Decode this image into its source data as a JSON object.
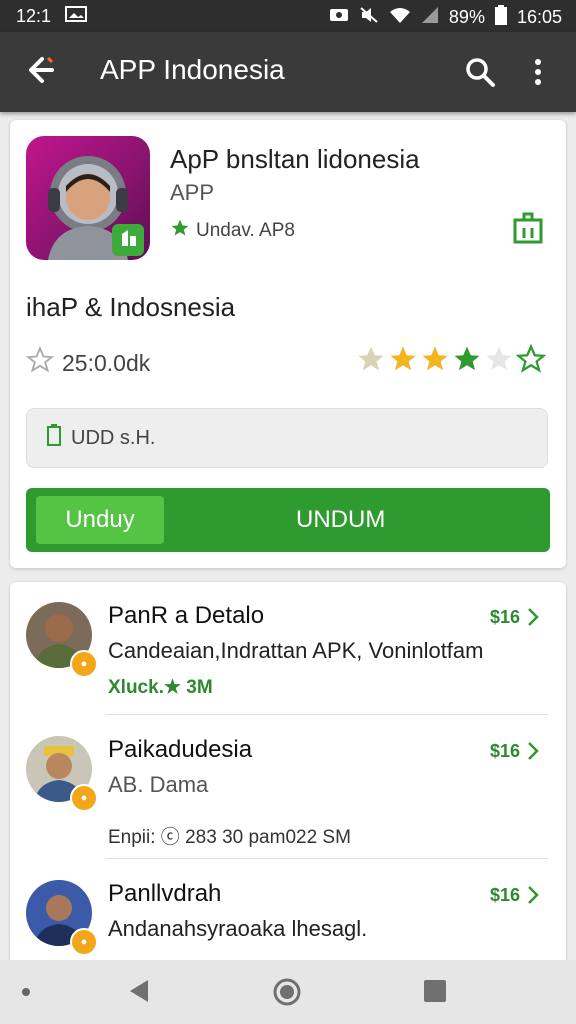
{
  "status": {
    "time": "16:05",
    "battery": "89%",
    "left_number": "12:1"
  },
  "appbar": {
    "title": "APP Indonesia"
  },
  "app": {
    "name": "ApP bnsltan lidonesia",
    "subtitle": "APP",
    "developer": "Undav. AP8",
    "section_title": "ihaP & Indosnesia",
    "downloads": "25:0.0dk",
    "info_text": "UDD s.H.",
    "install_left": "Unduy",
    "install_right": "UNDUM"
  },
  "list": [
    {
      "name": "PanR a Detalo",
      "desc": "Candeaian,Indrattan APK, Voninlotfam",
      "meta": "Xluck.★ 3M",
      "price": "$16"
    },
    {
      "name": "Paikadudesia",
      "desc": "AB. Dama",
      "meta2": "Enpii: ⓒ 283 30 pam022 SM",
      "price": "$16"
    },
    {
      "name": "Panllvdrah",
      "desc": "Andanahsyraoaka lhesagl.",
      "price": "$16"
    }
  ],
  "icons": [
    "back-arrow-icon",
    "search-icon",
    "more-vert-icon",
    "share-icon",
    "star-icon",
    "download-icon",
    "chevron-right-icon",
    "nav-back-icon",
    "nav-home-icon",
    "nav-recent-icon"
  ],
  "colors": {
    "accent": "#2f9a2f",
    "install_button": "#55c445",
    "appbar": "#3a3a3a",
    "statusbar": "#2e2e2e"
  }
}
